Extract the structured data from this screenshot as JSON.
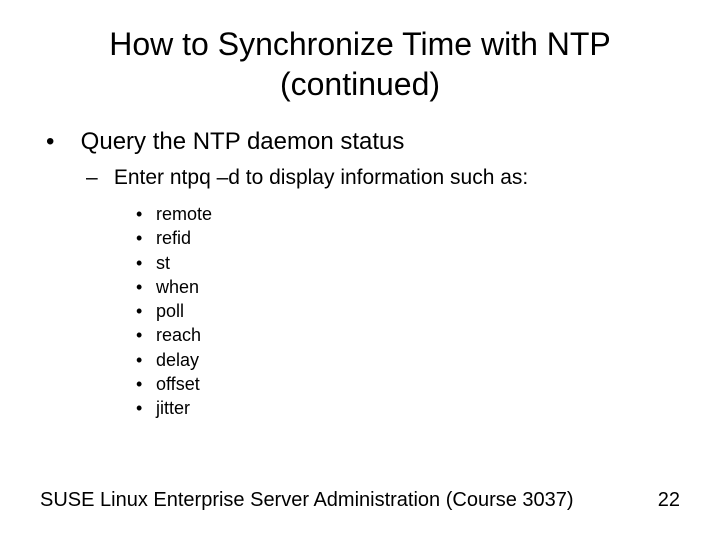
{
  "title_line1": "How to Synchronize Time with NTP",
  "title_line2": "(continued)",
  "level1": "Query the NTP daemon status",
  "level2": "Enter ntpq –d to display information such as:",
  "level3": [
    "remote",
    "refid",
    "st",
    "when",
    "poll",
    "reach",
    "delay",
    "offset",
    "jitter"
  ],
  "footer_text": "SUSE Linux Enterprise Server Administration (Course 3037)",
  "page_number": "22"
}
